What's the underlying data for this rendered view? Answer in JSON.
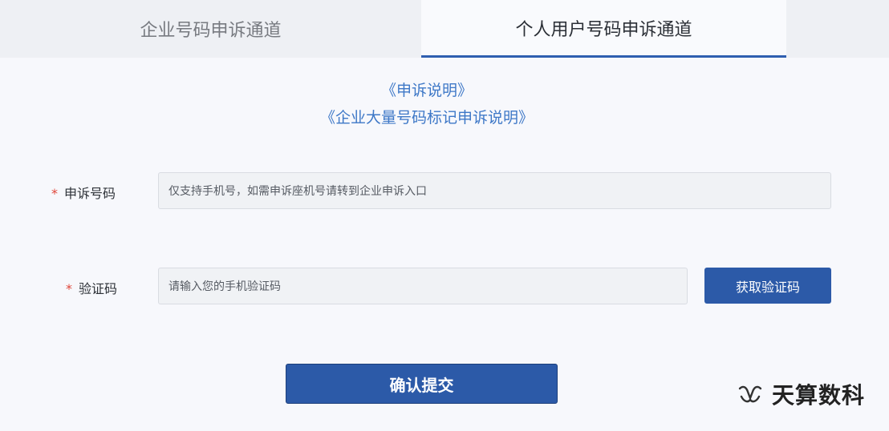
{
  "tabs": {
    "enterprise": "企业号码申诉通道",
    "personal": "个人用户号码申诉通道"
  },
  "links": {
    "appeal_notes": "《申诉说明》",
    "enterprise_notes": "《企业大量号码标记申诉说明》"
  },
  "form": {
    "phone": {
      "required_mark": "*",
      "label": "申诉号码",
      "placeholder": "仅支持手机号，如需申诉座机号请转到企业申诉入口"
    },
    "code": {
      "required_mark": "*",
      "label": "验证码",
      "placeholder": "请输入您的手机验证码",
      "get_code_button": "获取验证码"
    },
    "submit_button": "确认提交"
  },
  "watermark": {
    "text": "天算数科",
    "icon": "wechat-channel-icon"
  },
  "colors": {
    "accent": "#2c5aa8",
    "link": "#3e78c7",
    "required": "#e0463a"
  }
}
